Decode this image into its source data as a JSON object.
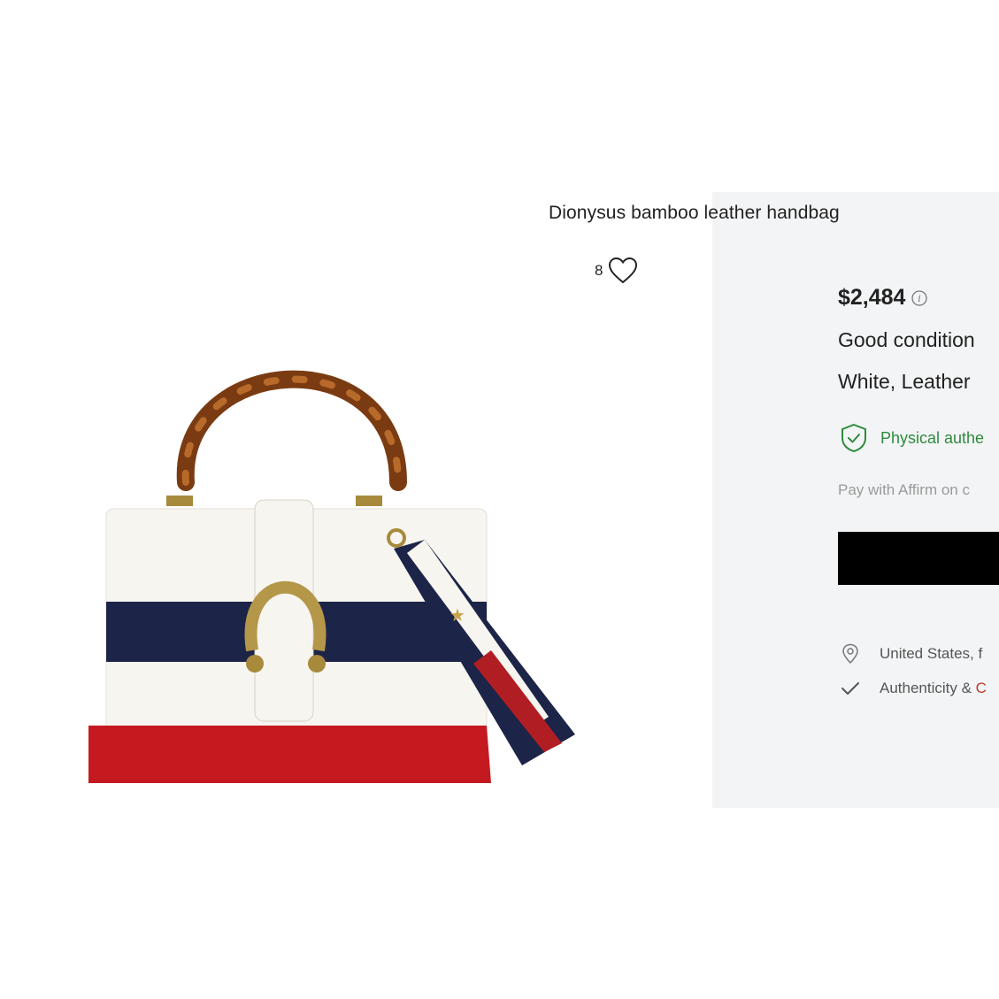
{
  "product": {
    "title": "Dionysus bamboo leather handbag",
    "likes_count": "8",
    "price": "$2,484",
    "condition": "Good condition",
    "color_material": "White, Leather",
    "authentication": "Physical authe",
    "affirm": "Pay with Affirm on c",
    "shipping_location": "United States, f",
    "authenticity_label": "Authenticity & ",
    "authenticity_suffix": "C"
  },
  "icons": {
    "like": "heart-icon",
    "price_info": "info-icon",
    "authentication": "shield-check-icon",
    "location": "location-pin-icon",
    "authenticity": "checkmark-icon"
  },
  "colors": {
    "panel_bg": "#f3f4f5",
    "auth_green": "#2e8b3e",
    "button_black": "#000000",
    "accent_red": "#c0392b",
    "muted_gray": "#9a9a9a"
  }
}
